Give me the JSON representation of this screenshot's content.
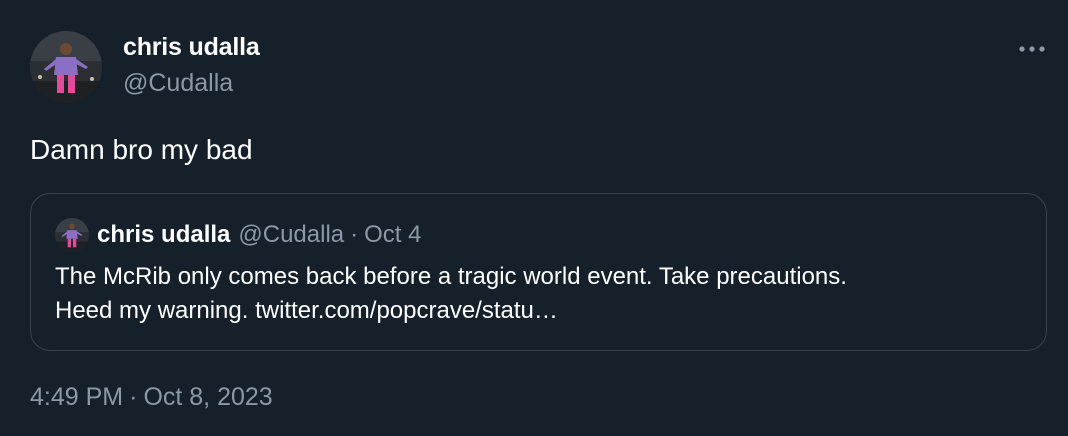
{
  "tweet": {
    "author": {
      "display_name": "chris udalla",
      "handle": "@Cudalla"
    },
    "text": "Damn bro my bad",
    "time": "4:49 PM",
    "separator": "·",
    "date": "Oct 8, 2023",
    "more_icon": "more-horizontal-icon"
  },
  "quoted_tweet": {
    "author": {
      "display_name": "chris udalla",
      "handle": "@Cudalla"
    },
    "separator": "·",
    "date": "Oct 4",
    "text_line_1": "The McRib only comes back before a tragic world event. Take precautions.",
    "text_line_2_prefix": "Heed my warning. ",
    "link_text": "twitter.com/popcrave/statu…"
  },
  "colors": {
    "background": "#15202b",
    "primary_text": "#ffffff",
    "secondary_text": "#8b98a5",
    "border": "#38444d"
  }
}
